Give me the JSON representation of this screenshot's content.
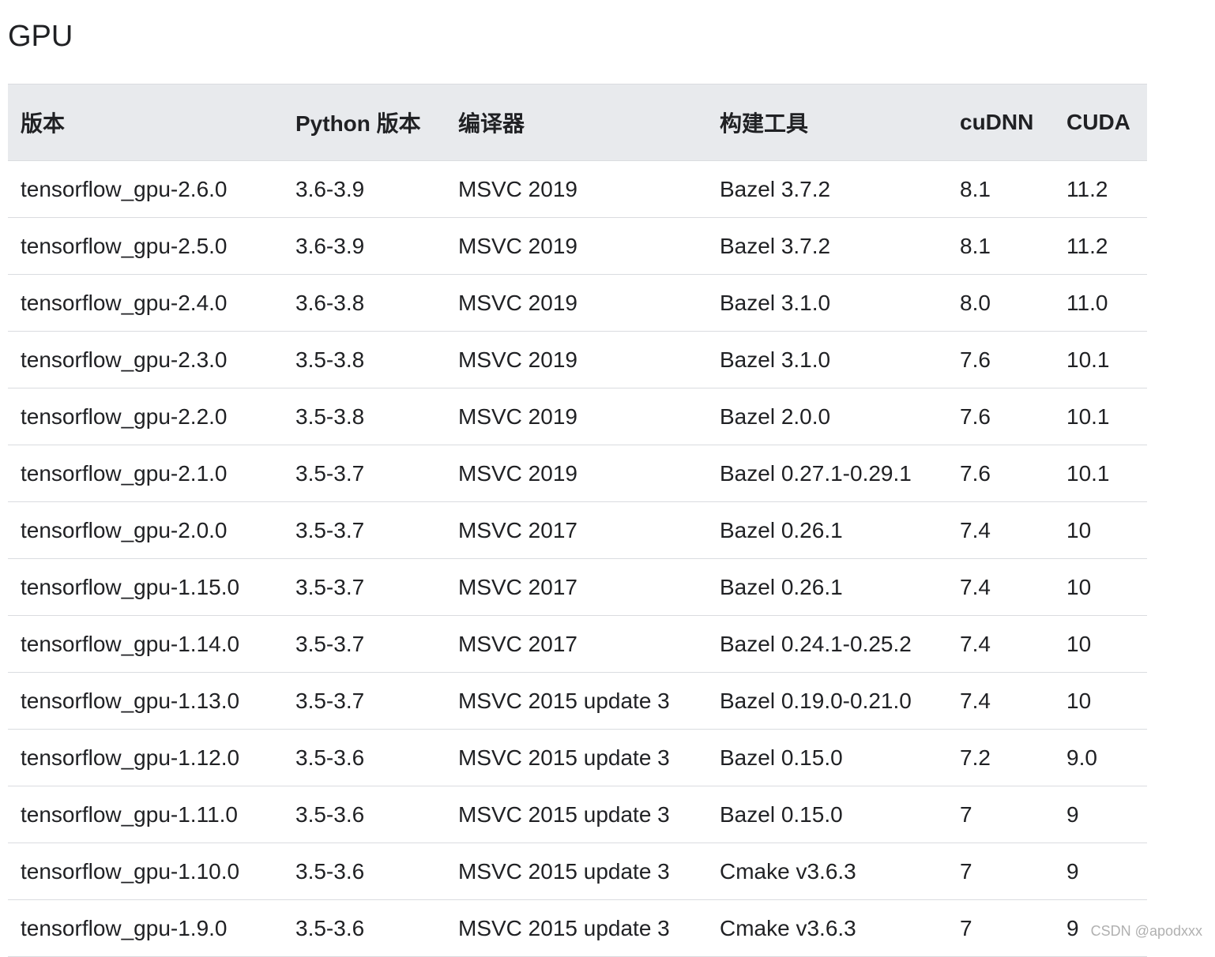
{
  "page": {
    "title": "GPU",
    "watermark": "CSDN @apodxxx"
  },
  "table": {
    "headers": [
      "版本",
      "Python 版本",
      "编译器",
      "构建工具",
      "cuDNN",
      "CUDA"
    ],
    "rows": [
      [
        "tensorflow_gpu-2.6.0",
        "3.6-3.9",
        "MSVC 2019",
        "Bazel 3.7.2",
        "8.1",
        "11.2"
      ],
      [
        "tensorflow_gpu-2.5.0",
        "3.6-3.9",
        "MSVC 2019",
        "Bazel 3.7.2",
        "8.1",
        "11.2"
      ],
      [
        "tensorflow_gpu-2.4.0",
        "3.6-3.8",
        "MSVC 2019",
        "Bazel 3.1.0",
        "8.0",
        "11.0"
      ],
      [
        "tensorflow_gpu-2.3.0",
        "3.5-3.8",
        "MSVC 2019",
        "Bazel 3.1.0",
        "7.6",
        "10.1"
      ],
      [
        "tensorflow_gpu-2.2.0",
        "3.5-3.8",
        "MSVC 2019",
        "Bazel 2.0.0",
        "7.6",
        "10.1"
      ],
      [
        "tensorflow_gpu-2.1.0",
        "3.5-3.7",
        "MSVC 2019",
        "Bazel 0.27.1-0.29.1",
        "7.6",
        "10.1"
      ],
      [
        "tensorflow_gpu-2.0.0",
        "3.5-3.7",
        "MSVC 2017",
        "Bazel 0.26.1",
        "7.4",
        "10"
      ],
      [
        "tensorflow_gpu-1.15.0",
        "3.5-3.7",
        "MSVC 2017",
        "Bazel 0.26.1",
        "7.4",
        "10"
      ],
      [
        "tensorflow_gpu-1.14.0",
        "3.5-3.7",
        "MSVC 2017",
        "Bazel 0.24.1-0.25.2",
        "7.4",
        "10"
      ],
      [
        "tensorflow_gpu-1.13.0",
        "3.5-3.7",
        "MSVC 2015 update 3",
        "Bazel 0.19.0-0.21.0",
        "7.4",
        "10"
      ],
      [
        "tensorflow_gpu-1.12.0",
        "3.5-3.6",
        "MSVC 2015 update 3",
        "Bazel 0.15.0",
        "7.2",
        "9.0"
      ],
      [
        "tensorflow_gpu-1.11.0",
        "3.5-3.6",
        "MSVC 2015 update 3",
        "Bazel 0.15.0",
        "7",
        "9"
      ],
      [
        "tensorflow_gpu-1.10.0",
        "3.5-3.6",
        "MSVC 2015 update 3",
        "Cmake v3.6.3",
        "7",
        "9"
      ],
      [
        "tensorflow_gpu-1.9.0",
        "3.5-3.6",
        "MSVC 2015 update 3",
        "Cmake v3.6.3",
        "7",
        "9"
      ]
    ]
  },
  "colors": {
    "header_bg": "#e8eaed",
    "border": "#dadce0",
    "text": "#202124",
    "watermark": "#b0b0b0"
  }
}
